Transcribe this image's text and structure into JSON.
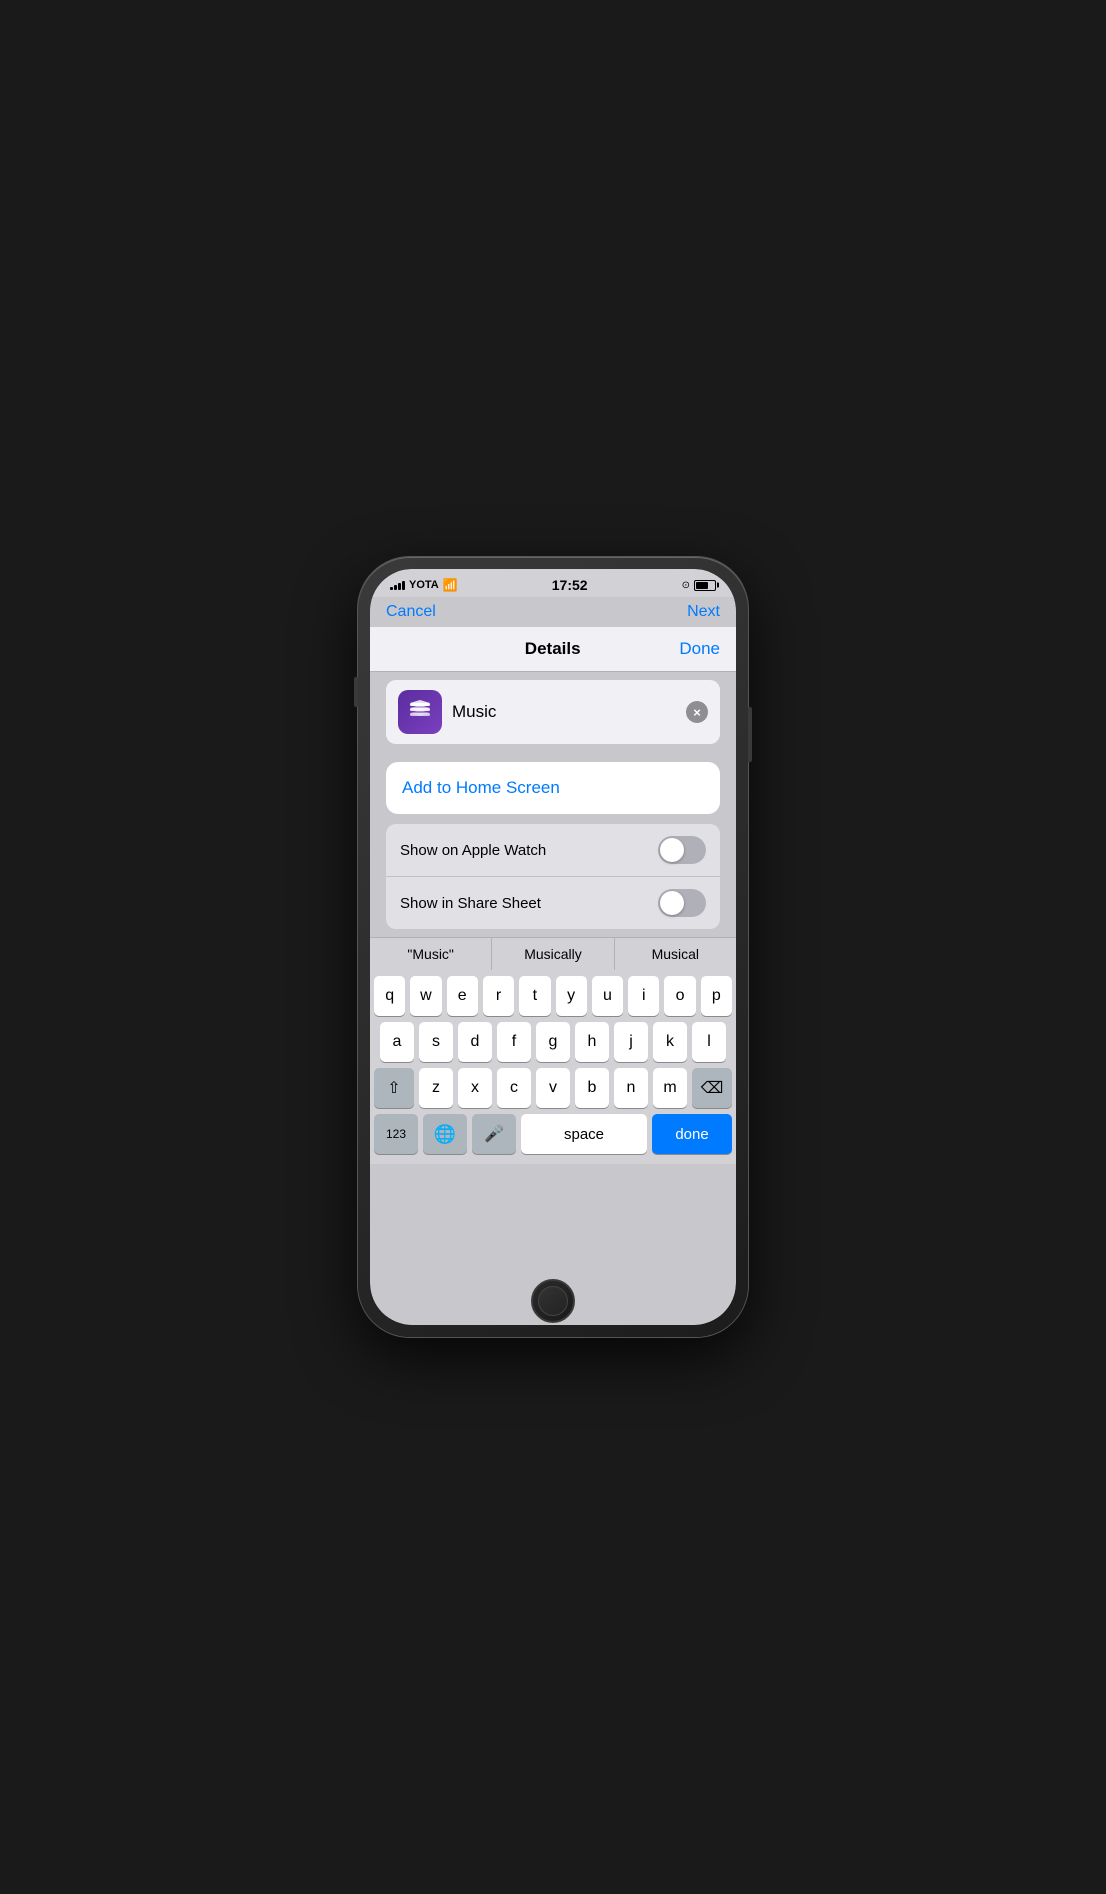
{
  "statusBar": {
    "carrier": "YOTA",
    "time": "17:52"
  },
  "nav": {
    "cancel": "Cancel",
    "next": "Next"
  },
  "details": {
    "title": "Details",
    "done": "Done"
  },
  "appRow": {
    "name": "Music",
    "clearBtn": "×"
  },
  "addHomeScreen": {
    "label": "Add to Home Screen"
  },
  "toggles": [
    {
      "label": "Show on Apple Watch"
    },
    {
      "label": "Show in Share Sheet"
    }
  ],
  "predictive": {
    "words": [
      "\"Music\"",
      "Musically",
      "Musical"
    ]
  },
  "keyboard": {
    "row1": [
      "q",
      "w",
      "e",
      "r",
      "t",
      "y",
      "u",
      "i",
      "o",
      "p"
    ],
    "row2": [
      "a",
      "s",
      "d",
      "f",
      "g",
      "h",
      "j",
      "k",
      "l"
    ],
    "row3": [
      "z",
      "x",
      "c",
      "v",
      "b",
      "n",
      "m"
    ],
    "space": "space",
    "done": "done"
  }
}
